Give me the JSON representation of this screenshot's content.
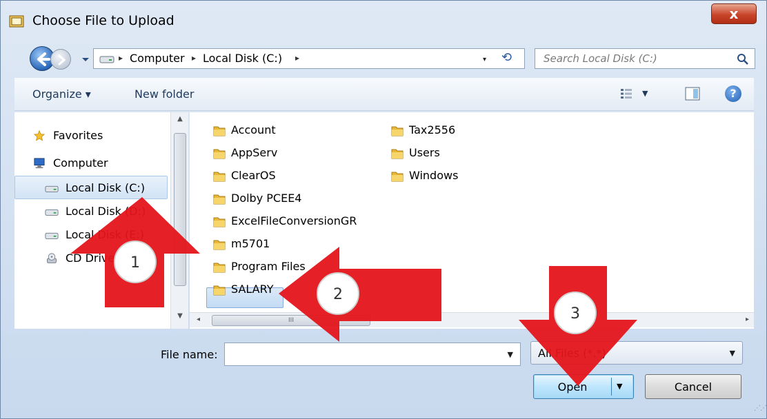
{
  "window": {
    "title": "Choose File to Upload",
    "close_glyph": "x"
  },
  "address_bar": {
    "crumbs": [
      "Computer",
      "Local Disk (C:)"
    ],
    "separator": "▸",
    "dropdown_glyph": "▾"
  },
  "search": {
    "placeholder": "Search Local Disk (C:)"
  },
  "toolbar": {
    "organize": "Organize ▾",
    "new_folder": "New folder",
    "help": "?"
  },
  "nav_pane": {
    "items": [
      {
        "label": "Favorites",
        "icon": "star-icon"
      },
      {
        "label": "Computer",
        "icon": "computer-icon"
      },
      {
        "label": "Local Disk (C:)",
        "icon": "drive-icon",
        "selected": true
      },
      {
        "label": "Local Disk (D:)",
        "icon": "drive-icon"
      },
      {
        "label": "Local Disk (E:)",
        "icon": "drive-icon"
      },
      {
        "label": "CD Drive",
        "icon": "cd-drive-icon"
      }
    ]
  },
  "files": {
    "column1": [
      "Account",
      "AppServ",
      "ClearOS",
      "Dolby PCEE4",
      "ExcelFileConversionGR",
      "m5701",
      "Program Files",
      "SALARY"
    ],
    "column2": [
      "Tax2556",
      "Users",
      "Windows"
    ],
    "selected": "SALARY"
  },
  "file_name": {
    "label": "File name:",
    "value": ""
  },
  "file_type": {
    "value": "All Files (*.*)"
  },
  "buttons": {
    "open": "Open",
    "cancel": "Cancel"
  },
  "annotations": [
    {
      "number": "1",
      "color": "#e4151b"
    },
    {
      "number": "2",
      "color": "#e4151b"
    },
    {
      "number": "3",
      "color": "#e4151b"
    }
  ],
  "colors": {
    "arrow": "#e4151b",
    "selection": "#cce4f7",
    "accent": "#1e395b"
  }
}
